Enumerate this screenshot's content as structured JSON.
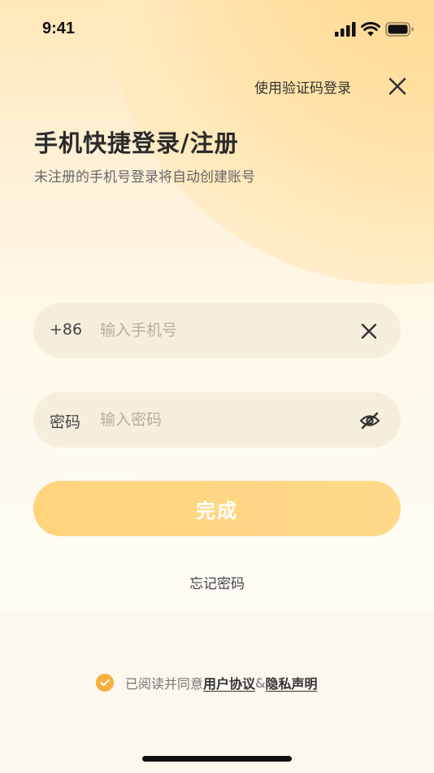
{
  "status_bar": {
    "time": "9:41"
  },
  "header": {
    "switch_login": "使用验证码登录"
  },
  "title": "手机快捷登录/注册",
  "subtitle": "未注册的手机号登录将自动创建账号",
  "phone_field": {
    "prefix": "+86",
    "placeholder": "输入手机号",
    "value": ""
  },
  "password_field": {
    "label": "密码",
    "placeholder": "输入密码",
    "value": ""
  },
  "submit_label": "完成",
  "forgot_label": "忘记密码",
  "agreement": {
    "text": "已阅读并同意",
    "user_agreement": "用户协议",
    "separator": "&",
    "privacy": "隐私声明",
    "checked": true
  },
  "colors": {
    "accent": "#ffd47c",
    "check": "#f5b13d",
    "field_bg": "#f6eedd"
  }
}
